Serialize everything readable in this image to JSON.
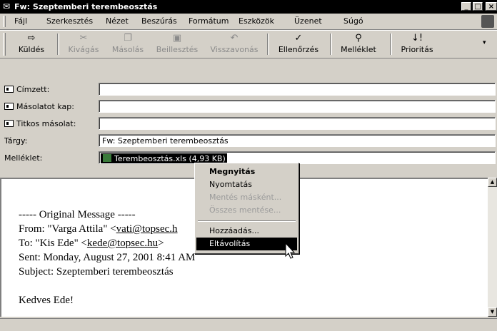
{
  "window": {
    "title": "Fw: Szeptemberi terembeosztás",
    "controls": [
      "_",
      "□",
      "×"
    ]
  },
  "menu": {
    "items": [
      "Fájl",
      "Szerkesztés",
      "Nézet",
      "Beszúrás",
      "Formátum",
      "Eszközök",
      "Üzenet",
      "Súgó"
    ]
  },
  "toolbar": {
    "buttons": [
      {
        "label": "Küldés",
        "icon": "send-icon",
        "enabled": true
      },
      {
        "label": "Kivágás",
        "icon": "scissors-icon",
        "enabled": false
      },
      {
        "label": "Másolás",
        "icon": "copy-icon",
        "enabled": false
      },
      {
        "label": "Beillesztés",
        "icon": "paste-icon",
        "enabled": false
      },
      {
        "label": "Visszavonás",
        "icon": "undo-icon",
        "enabled": false
      },
      {
        "label": "Ellenőrzés",
        "icon": "check-names-icon",
        "enabled": true
      },
      {
        "label": "Melléklet",
        "icon": "paperclip-icon",
        "enabled": true
      },
      {
        "label": "Prioritás",
        "icon": "priority-icon",
        "enabled": true
      }
    ]
  },
  "header": {
    "to_label": "Címzett:",
    "to_value": "",
    "cc_label": "Másolatot kap:",
    "cc_value": "",
    "bcc_label": "Titkos másolat:",
    "bcc_value": "",
    "subject_label": "Tárgy:",
    "subject_value": "Fw: Szeptemberi terembeosztás",
    "attach_label": "Melléklet:",
    "attachment": "Terembeosztás.xls (4,93 KB)"
  },
  "body": {
    "line1": "----- Original Message -----",
    "from_prefix": "From: \"Varga Attila\" <",
    "from_email": "vati@topsec.h",
    "to_prefix": "To: \"Kis Ede\" <",
    "to_email": "kede@topsec.hu",
    "to_suffix": ">",
    "sent": "Sent: Monday, August 27, 2001 8:41 AM",
    "subject": "Subject: Szeptemberi terembeosztás",
    "greeting": "Kedves Ede!"
  },
  "context_menu": {
    "items": [
      {
        "label": "Megnyitás",
        "state": "default"
      },
      {
        "label": "Nyomtatás",
        "state": "normal"
      },
      {
        "label": "Mentés másként...",
        "state": "disabled"
      },
      {
        "label": "Összes mentése...",
        "state": "disabled"
      },
      {
        "label": "Hozzáadás...",
        "state": "normal"
      },
      {
        "label": "Eltávolítás",
        "state": "selected"
      }
    ]
  }
}
